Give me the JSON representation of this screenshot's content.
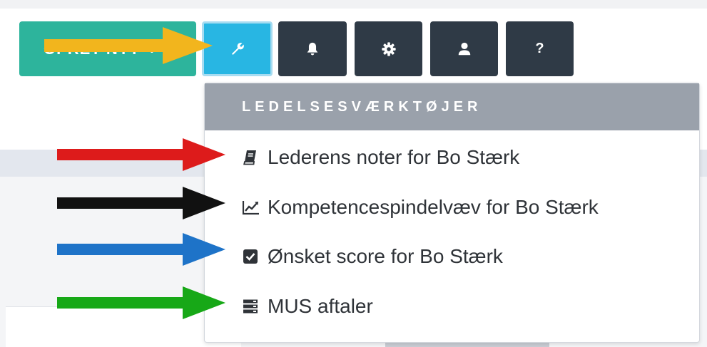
{
  "toolbar": {
    "create_label": "OPRET NYT",
    "create_plus": "+",
    "help_glyph": "?",
    "buttons": [
      {
        "icon": "wrench-icon",
        "active": true
      },
      {
        "icon": "bell-icon",
        "active": false
      },
      {
        "icon": "gear-icon",
        "active": false
      },
      {
        "icon": "user-icon",
        "active": false
      },
      {
        "icon": "help-icon",
        "active": false
      }
    ]
  },
  "menu": {
    "header": "LEDELSESVÆRKTØJER",
    "items": [
      {
        "label": "Lederens noter for Bo Stærk",
        "icon": "book-icon"
      },
      {
        "label": "Kompetencespindelvæv for Bo Stærk",
        "icon": "chart-line-icon"
      },
      {
        "label": "Ønsket score for Bo Stærk",
        "icon": "checkbox-icon"
      },
      {
        "label": "MUS aftaler",
        "icon": "server-icon"
      }
    ]
  },
  "annotations": {
    "arrows": [
      {
        "color": "#f2b51d",
        "target": "wrench-button"
      },
      {
        "color": "#dd1b1b",
        "target": "Lederens noter for Bo Stærk"
      },
      {
        "color": "#111111",
        "target": "Kompetencespindelvæv for Bo Stærk"
      },
      {
        "color": "#1e73c8",
        "target": "Ønsket score for Bo Stærk"
      },
      {
        "color": "#17a817",
        "target": "MUS aftaler"
      }
    ]
  },
  "colors": {
    "create_button": "#2db49c",
    "active_tool": "#28b6e3",
    "tool_button": "#2f3a46",
    "menu_header": "#9aa1ab"
  }
}
